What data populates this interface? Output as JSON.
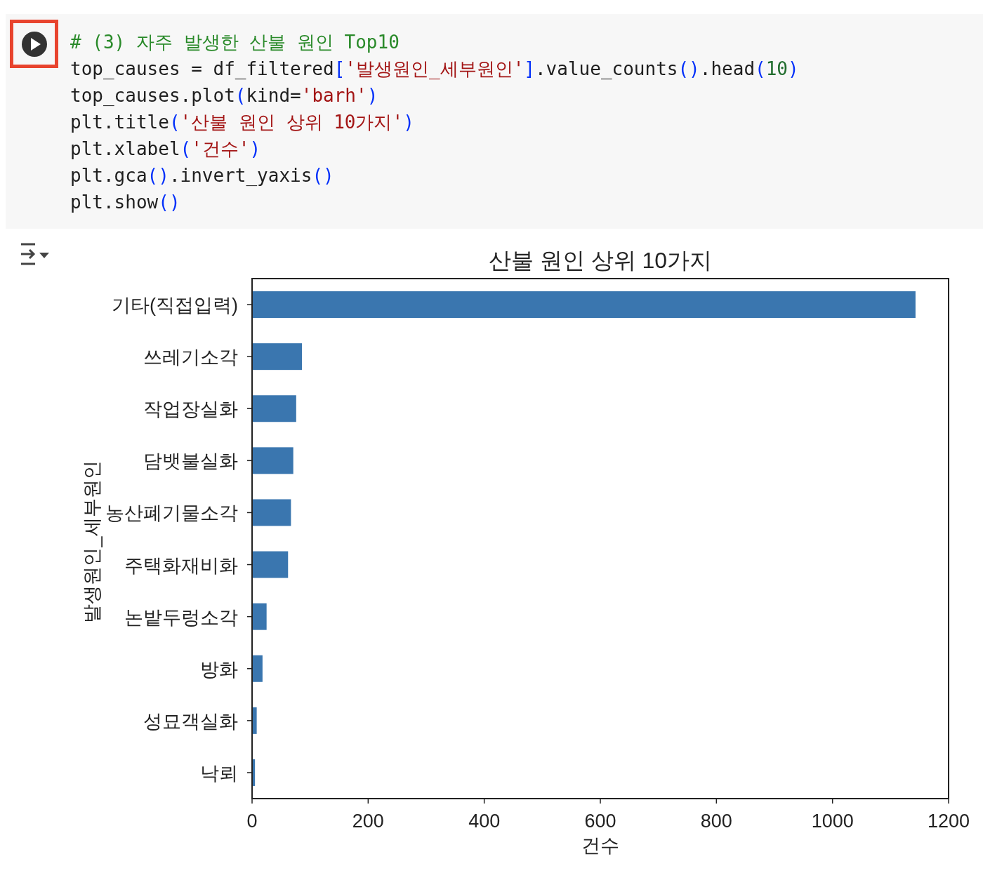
{
  "code_cell": {
    "lines": [
      [
        {
          "kind": "comment",
          "text": "# (3) 자주 발생한 산불 원인 Top10"
        }
      ],
      [
        {
          "kind": "plain",
          "text": "top_causes = df_filtered"
        },
        {
          "kind": "bracket",
          "text": "["
        },
        {
          "kind": "string",
          "text": "'발생원인_세부원인'"
        },
        {
          "kind": "bracket",
          "text": "]"
        },
        {
          "kind": "plain",
          "text": ".value_counts"
        },
        {
          "kind": "bracket",
          "text": "()"
        },
        {
          "kind": "plain",
          "text": ".head"
        },
        {
          "kind": "bracket",
          "text": "("
        },
        {
          "kind": "number",
          "text": "10"
        },
        {
          "kind": "bracket",
          "text": ")"
        }
      ],
      [
        {
          "kind": "plain",
          "text": "top_causes.plot"
        },
        {
          "kind": "bracket",
          "text": "("
        },
        {
          "kind": "plain",
          "text": "kind="
        },
        {
          "kind": "string",
          "text": "'barh'"
        },
        {
          "kind": "bracket",
          "text": ")"
        }
      ],
      [
        {
          "kind": "plain",
          "text": "plt.title"
        },
        {
          "kind": "bracket",
          "text": "("
        },
        {
          "kind": "string",
          "text": "'산불 원인 상위 10가지'"
        },
        {
          "kind": "bracket",
          "text": ")"
        }
      ],
      [
        {
          "kind": "plain",
          "text": "plt.xlabel"
        },
        {
          "kind": "bracket",
          "text": "("
        },
        {
          "kind": "string",
          "text": "'건수'"
        },
        {
          "kind": "bracket",
          "text": ")"
        }
      ],
      [
        {
          "kind": "plain",
          "text": "plt.gca"
        },
        {
          "kind": "bracket",
          "text": "()"
        },
        {
          "kind": "plain",
          "text": ".invert_yaxis"
        },
        {
          "kind": "bracket",
          "text": "()"
        }
      ],
      [
        {
          "kind": "plain",
          "text": "plt.show"
        },
        {
          "kind": "bracket",
          "text": "()"
        }
      ]
    ]
  },
  "output": {
    "chart_data": {
      "type": "bar",
      "orientation": "horizontal",
      "title": "산불 원인 상위 10가지",
      "xlabel": "건수",
      "ylabel": "발생원인_세부원인",
      "categories": [
        "기타(직접입력)",
        "쓰레기소각",
        "작업장실화",
        "담뱃불실화",
        "농산폐기물소각",
        "주택화재비화",
        "논밭두렁소각",
        "방화",
        "성묘객실화",
        "낙뢰"
      ],
      "series": [
        {
          "color": "#3a76af",
          "values": [
            1143,
            86,
            76,
            71,
            67,
            62,
            25,
            18,
            8,
            5
          ]
        }
      ],
      "xlim": [
        0,
        1200
      ],
      "xticks": [
        0,
        200,
        400,
        600,
        800,
        1000,
        1200
      ]
    }
  }
}
